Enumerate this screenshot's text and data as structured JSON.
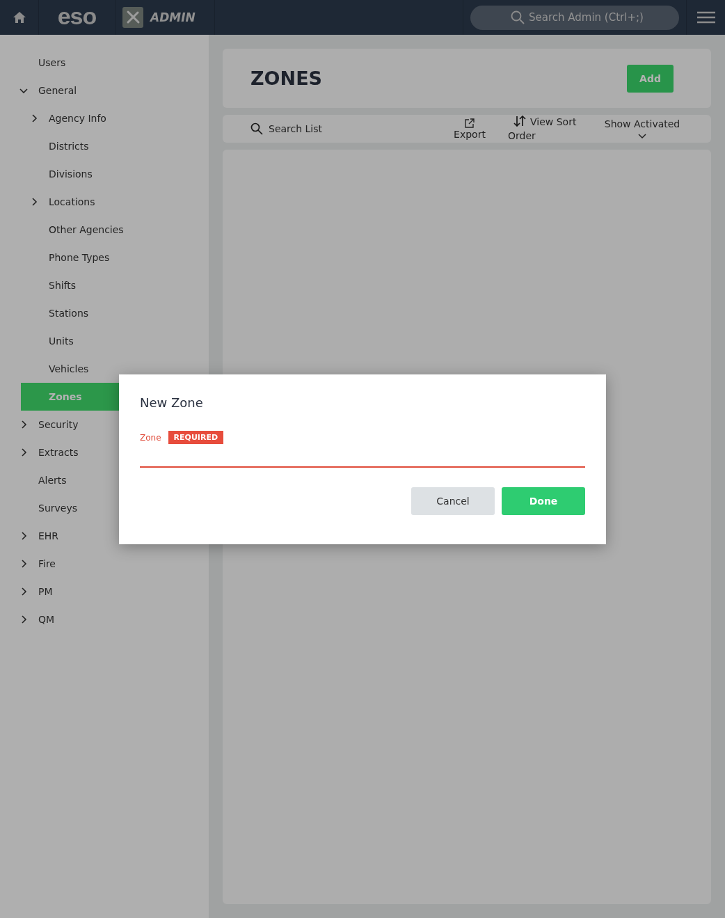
{
  "header": {
    "product": "eso",
    "module": "ADMIN",
    "search": {
      "placeholder": "Search Admin (Ctrl+;)"
    }
  },
  "sidebar": {
    "items": [
      {
        "label": "Users",
        "kind": "link",
        "selected": false
      },
      {
        "label": "General",
        "kind": "group",
        "expanded": true,
        "selected": false,
        "children": [
          {
            "label": "Agency Info",
            "kind": "group",
            "expanded": false,
            "selected": false
          },
          {
            "label": "Districts",
            "kind": "link",
            "selected": false
          },
          {
            "label": "Divisions",
            "kind": "link",
            "selected": false
          },
          {
            "label": "Locations",
            "kind": "group",
            "expanded": false,
            "selected": false
          },
          {
            "label": "Other Agencies",
            "kind": "link",
            "selected": false
          },
          {
            "label": "Phone Types",
            "kind": "link",
            "selected": false
          },
          {
            "label": "Shifts",
            "kind": "link",
            "selected": false
          },
          {
            "label": "Stations",
            "kind": "link",
            "selected": false
          },
          {
            "label": "Units",
            "kind": "link",
            "selected": false
          },
          {
            "label": "Vehicles",
            "kind": "link",
            "selected": false
          },
          {
            "label": "Zones",
            "kind": "link",
            "selected": true
          }
        ]
      },
      {
        "label": "Security",
        "kind": "group",
        "expanded": false,
        "selected": false
      },
      {
        "label": "Extracts",
        "kind": "group",
        "expanded": false,
        "selected": false
      },
      {
        "label": "Alerts",
        "kind": "link",
        "selected": false
      },
      {
        "label": "Surveys",
        "kind": "link",
        "selected": false
      },
      {
        "label": "EHR",
        "kind": "group",
        "expanded": false,
        "selected": false
      },
      {
        "label": "Fire",
        "kind": "group",
        "expanded": false,
        "selected": false
      },
      {
        "label": "PM",
        "kind": "group",
        "expanded": false,
        "selected": false
      },
      {
        "label": "QM",
        "kind": "group",
        "expanded": false,
        "selected": false
      }
    ]
  },
  "page": {
    "title": "ZONES",
    "add_button": "Add"
  },
  "toolbar": {
    "search": {
      "placeholder": "Search List"
    },
    "export": "Export",
    "sort": "View Sort Order",
    "filter": "Show Activated"
  },
  "dialog": {
    "title": "New Zone",
    "field": {
      "label": "Zone",
      "badge": "REQUIRED",
      "invalid": true
    },
    "buttons": [
      {
        "label": "Cancel",
        "kind": "secondary"
      },
      {
        "label": "Done",
        "kind": "primary"
      }
    ]
  }
}
